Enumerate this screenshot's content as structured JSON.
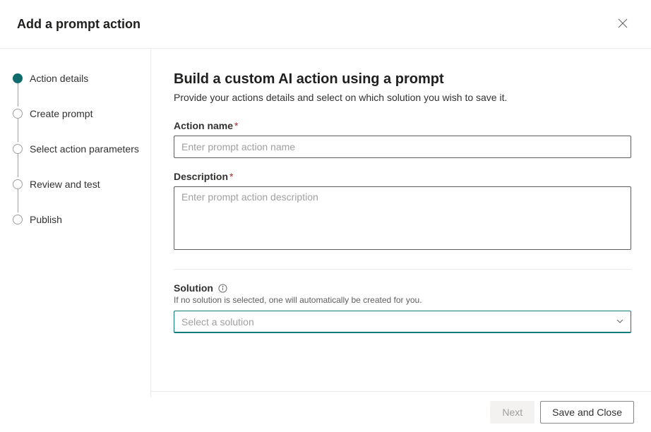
{
  "header": {
    "title": "Add a prompt action"
  },
  "sidebar": {
    "steps": [
      {
        "label": "Action details",
        "active": true
      },
      {
        "label": "Create prompt",
        "active": false
      },
      {
        "label": "Select action parameters",
        "active": false
      },
      {
        "label": "Review and test",
        "active": false
      },
      {
        "label": "Publish",
        "active": false
      }
    ]
  },
  "main": {
    "title": "Build a custom AI action using a prompt",
    "subtitle": "Provide your actions details and select on which solution you wish to save it.",
    "action_name": {
      "label": "Action name",
      "placeholder": "Enter prompt action name",
      "value": ""
    },
    "description": {
      "label": "Description",
      "placeholder": "Enter prompt action description",
      "value": ""
    },
    "solution": {
      "label": "Solution",
      "helper": "If no solution is selected, one will automatically be created for you.",
      "placeholder": "Select a solution"
    }
  },
  "footer": {
    "next_label": "Next",
    "save_close_label": "Save and Close"
  }
}
